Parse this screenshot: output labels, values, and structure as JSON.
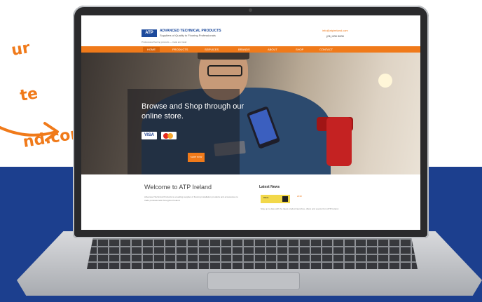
{
  "handwriting": {
    "line1": "ur",
    "line2": "te",
    "line3": "nd.com"
  },
  "site": {
    "logo": "ATP",
    "brand_name": "ADVANCED TECHNICAL PRODUCTS",
    "brand_tagline": "Suppliers of Quality to Flooring Professionals",
    "brand_sub": "Professional flooring products — trade and retail",
    "contact_email": "info@atpireland.com",
    "contact_phone": "(01) 000 0000",
    "nav": [
      {
        "label": "HOME"
      },
      {
        "label": "PRODUCTS"
      },
      {
        "label": "SERVICES"
      },
      {
        "label": "BRANDS"
      },
      {
        "label": "ABOUT"
      },
      {
        "label": "SHOP"
      },
      {
        "label": "CONTACT"
      }
    ],
    "hero": {
      "headline": "Browse and Shop through our online store.",
      "visa": "VISA",
      "button": "SHOP NOW"
    },
    "welcome": {
      "title": "Welcome to ATP Ireland",
      "body": "Advanced Technical Products is a leading supplier of flooring installation products and accessories to trade professionals throughout Ireland."
    },
    "news": {
      "title": "Latest News",
      "thumb_label": "DEAL",
      "date": "2018",
      "body": "Stay up to date with the latest product launches, offers and events from ATP Ireland."
    }
  }
}
